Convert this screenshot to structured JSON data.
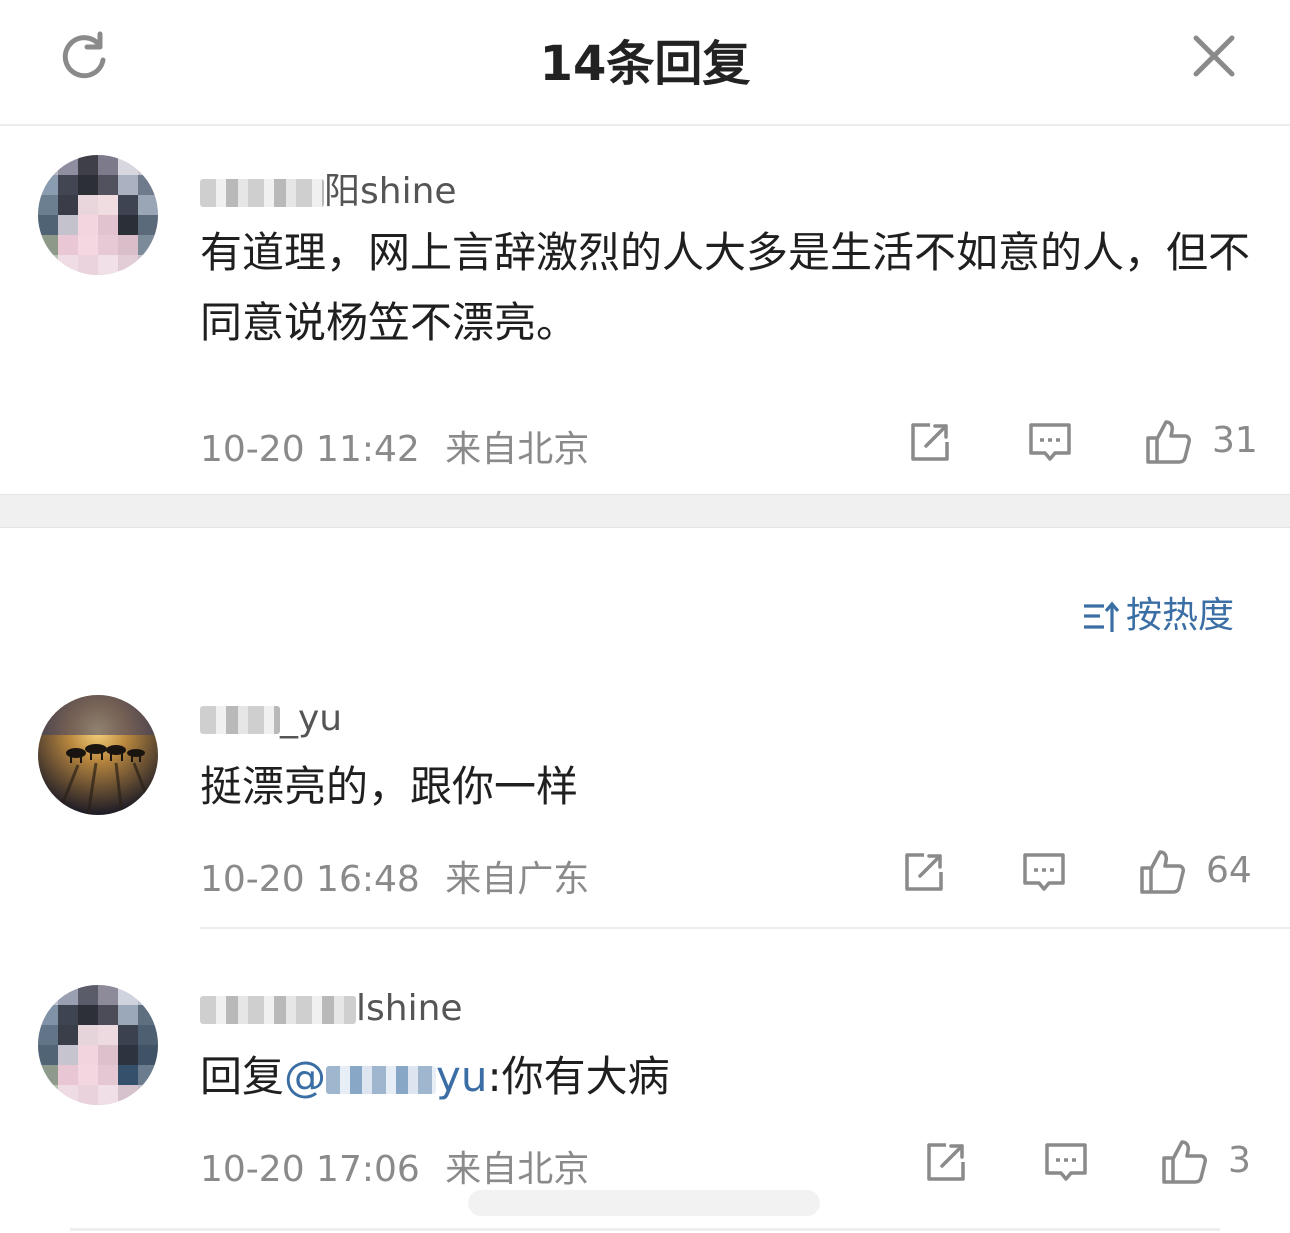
{
  "header": {
    "title": "14条回复",
    "refresh_icon": "refresh-icon",
    "close_icon": "close-icon"
  },
  "main_comment": {
    "username_suffix": "阳shine",
    "text": "有道理，网上言辞激烈的人大多是生活不如意的人，但不同意说杨笠不漂亮。",
    "time": "10-20 11:42",
    "location": "来自北京",
    "likes": "31"
  },
  "sort": {
    "label": "按热度",
    "icon": "sort-icon"
  },
  "replies": [
    {
      "username_suffix": "_yu",
      "text": "挺漂亮的，跟你一样",
      "time": "10-20 16:48",
      "location": "来自广东",
      "likes": "64"
    },
    {
      "username_suffix": "lshine",
      "text_prefix": "回复",
      "mention_prefix": "@",
      "mention_suffix": "yu",
      "text_suffix": ":你有大病",
      "time": "10-20 17:06",
      "location": "来自北京",
      "likes": "3"
    }
  ],
  "colors": {
    "accent": "#3a6ea5",
    "meta": "#8a8a8a",
    "text": "#1f1f1f",
    "band": "#f0f0f0"
  }
}
